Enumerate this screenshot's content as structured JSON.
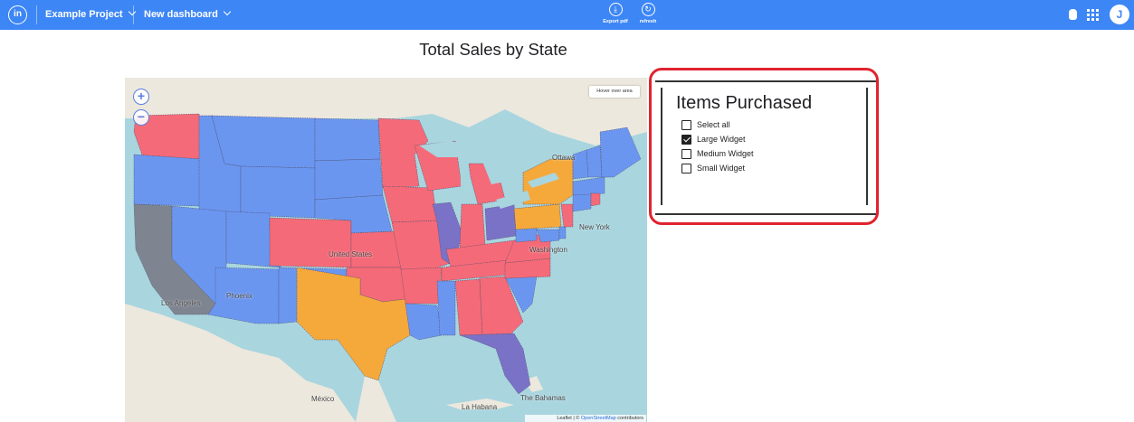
{
  "topbar": {
    "logo": "in",
    "project": "Example Project",
    "dashboard": "New dashboard",
    "tools": [
      {
        "label": "Export pdf",
        "glyph": "⤓"
      },
      {
        "label": "refresh",
        "glyph": "↻"
      }
    ],
    "avatar_initial": "J"
  },
  "page_title": "Total Sales by State",
  "map": {
    "hover_hint": "Hover over area",
    "attribution_prefix": "Leaflet | © ",
    "attribution_link": "OpenStreetMap",
    "attribution_suffix": " contributors",
    "zoom_in": "+",
    "zoom_out": "−",
    "cities": {
      "ottawa": "Ottawa",
      "new_york": "New York",
      "washington": "Washington",
      "united_states": "United States",
      "phoenix": "Phoenix",
      "los_angeles": "Los Angeles",
      "mexico": "México",
      "la_habana": "La Habana",
      "bahamas": "The Bahamas"
    },
    "colors": {
      "water": "#a9d5df",
      "land": "#ece8dd",
      "blue": "#6b96f0",
      "red": "#f56a78",
      "orange": "#f5a93b",
      "purple": "#7a72c6",
      "gray": "#7f8590"
    }
  },
  "filter": {
    "title": "Items Purchased",
    "options": [
      {
        "label": "Select all",
        "checked": false
      },
      {
        "label": "Large Widget",
        "checked": true
      },
      {
        "label": "Medium Widget",
        "checked": false
      },
      {
        "label": "Small Widget",
        "checked": false
      }
    ]
  },
  "colors": {
    "topbar": "#3d86f5",
    "highlight": "#e0242f"
  }
}
